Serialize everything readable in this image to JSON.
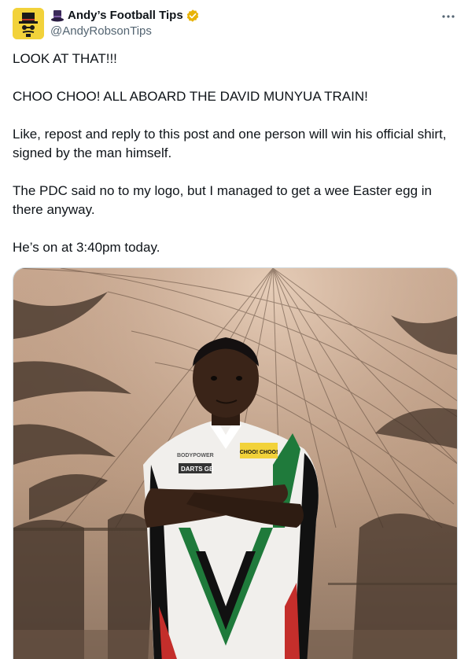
{
  "author": {
    "display_name": "Andy’s Football Tips",
    "handle": "@AndyRobsonTips",
    "emoji": "top-hat-icon",
    "verified": true,
    "verified_color": "#e8b308"
  },
  "post": {
    "paragraphs": [
      "LOOK AT THAT!!!",
      "CHOO CHOO! ALL ABOARD THE DAVID MUNYUA TRAIN!",
      "Like, repost and reply to this post and one person will win his official shirt, signed by the man himself.",
      "The PDC said no to my logo, but I managed to get a wee Easter egg in there anyway.",
      "He’s on at 3:40pm today."
    ]
  },
  "media": {
    "shirt_sponsor_1": "BODYPOWER",
    "shirt_sponsor_2": "DARTS GB",
    "shirt_badge": "CHOO! CHOO!"
  },
  "colors": {
    "avatar_bg": "#f2d23a",
    "text": "#0f1419",
    "secondary_text": "#536471"
  }
}
